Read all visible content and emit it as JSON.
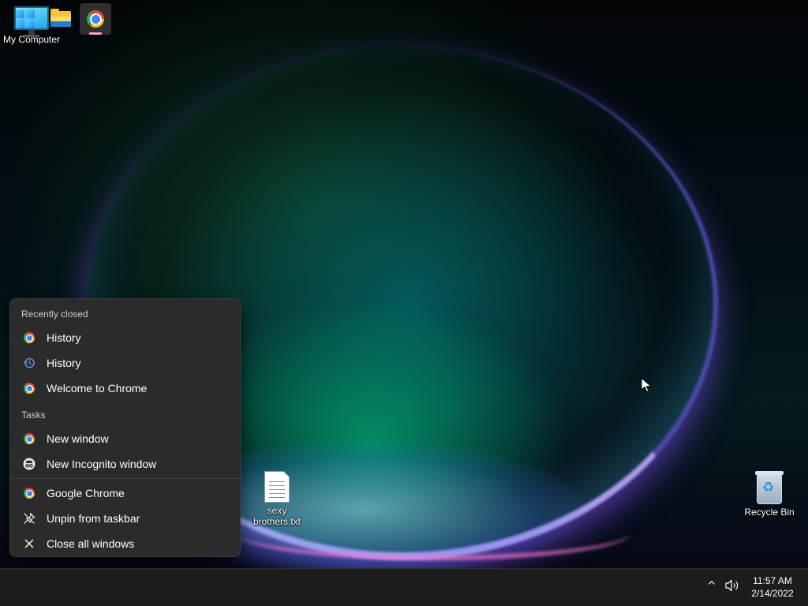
{
  "desktop": {
    "icons": [
      {
        "label": "My Computer",
        "icon": "computer-icon"
      },
      {
        "label": "sexy brothers.txt",
        "icon": "text-file-icon"
      },
      {
        "label": "Recycle Bin",
        "icon": "recycle-bin-icon"
      }
    ]
  },
  "jumplist": {
    "recently_closed_header": "Recently closed",
    "recently_closed": [
      {
        "label": "History",
        "icon": "chrome-icon"
      },
      {
        "label": "History",
        "icon": "history-icon"
      },
      {
        "label": "Welcome to Chrome",
        "icon": "chrome-icon"
      }
    ],
    "tasks_header": "Tasks",
    "tasks": [
      {
        "label": "New window",
        "icon": "chrome-icon"
      },
      {
        "label": "New Incognito window",
        "icon": "incognito-icon"
      }
    ],
    "app_actions": [
      {
        "label": "Google Chrome",
        "icon": "chrome-icon"
      },
      {
        "label": "Unpin from taskbar",
        "icon": "unpin-icon"
      },
      {
        "label": "Close all windows",
        "icon": "close-icon"
      }
    ]
  },
  "taskbar": {
    "apps": [
      {
        "name": "Start",
        "icon": "windows-start-icon"
      },
      {
        "name": "File Explorer",
        "icon": "folder-icon"
      },
      {
        "name": "Google Chrome",
        "icon": "chrome-icon",
        "active": true
      }
    ],
    "tray": {
      "chevron": "^",
      "time": "11:57 AM",
      "date": "2/14/2022"
    }
  },
  "colors": {
    "taskbar_bg": "#1c1c1c",
    "menu_bg": "#2b2b2b",
    "active_indicator": "#f2a9c7"
  }
}
